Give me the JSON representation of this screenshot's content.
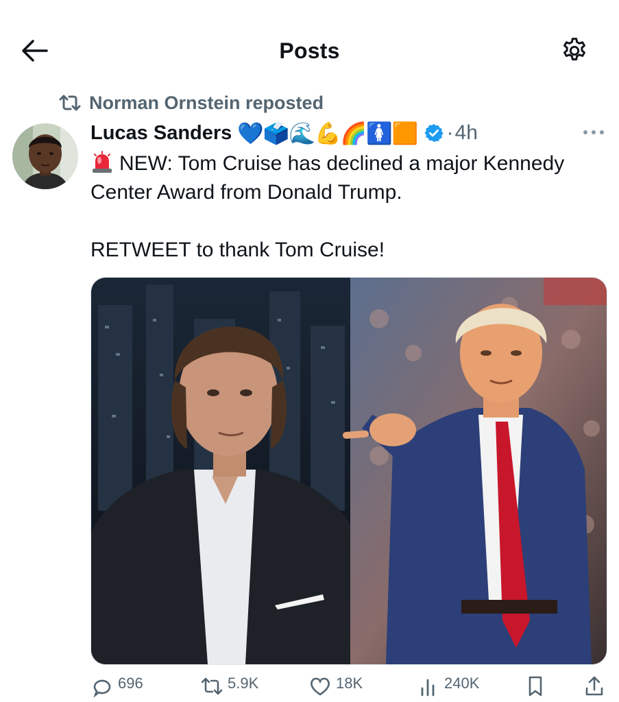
{
  "header": {
    "title": "Posts",
    "back_icon": "arrow-left-icon",
    "settings_icon": "gear-icon"
  },
  "repost": {
    "text": "Norman Ornstein reposted",
    "icon": "repost-icon"
  },
  "post": {
    "author_name": "Lucas Sanders",
    "author_emojis": "💙🗳️🌊💪🌈🚺🟧",
    "verified": true,
    "separator": "·",
    "time": "4h",
    "line1": "NEW: Tom Cruise has declined a major Kennedy",
    "line2": "Center Award from Donald Trump.",
    "line3": "RETWEET to thank Tom Cruise!",
    "siren_icon": "rotating-light-icon"
  },
  "actions": {
    "replies": "696",
    "reposts": "5.9K",
    "likes": "18K",
    "views": "240K"
  },
  "colors": {
    "text": "#0f1419",
    "secondary": "#536471",
    "verified_blue": "#1d9bf0"
  }
}
